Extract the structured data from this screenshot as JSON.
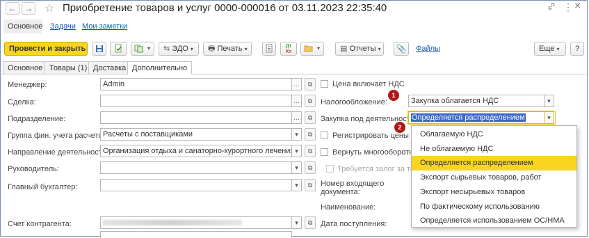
{
  "window": {
    "title": "Приобретение товаров и услуг 0000-000016 от 03.11.2023 22:35:40"
  },
  "nav": {
    "back": "←",
    "forward": "→",
    "star": "☆",
    "link_icon": "🔗",
    "menu_icon": "⋮",
    "close_icon": "×"
  },
  "top_tabs": [
    "Основное",
    "Задачи",
    "Мои заметки"
  ],
  "toolbar": {
    "post_close": "Провести и закрыть",
    "edo": "ЭДО",
    "print": "Печать",
    "reports": "Отчеты",
    "files": "Файлы",
    "more": "Еще",
    "help": "?"
  },
  "tabs": [
    "Основное",
    "Товары (1)",
    "Доставка",
    "Дополнительно"
  ],
  "left_fields": [
    {
      "label": "Менеджер:",
      "value": "Admin"
    },
    {
      "label": "Сделка:",
      "value": ""
    },
    {
      "label": "Подразделение:",
      "value": ""
    },
    {
      "label": "Группа фин. учета расчетов:",
      "value": "Расчеты с поставщиками"
    },
    {
      "label": "Направление деятельности:",
      "value": "Организация отдыха и санаторно-курортного лечения"
    },
    {
      "label": "Руководитель:",
      "value": ""
    },
    {
      "label": "Главный бухгалтер:",
      "value": ""
    },
    {
      "label": "Счет контрагента:",
      "value": ""
    }
  ],
  "right": {
    "price_vat_label": "Цена включает НДС",
    "taxation_label": "Налогообложение:",
    "taxation_value": "Закупка облагается НДС",
    "activity_label": "Закупка под деятельность:",
    "activity_value": "Определяется распределением",
    "register_label": "Регистрировать цены пос",
    "return_label": "Вернуть многооборотнук",
    "deposit_label": "Требуется залог за тару",
    "incoming_number_label": "Номер входящего документа:",
    "name_label": "Наименование:",
    "receipt_date_label": "Дата поступления:"
  },
  "badges": {
    "one": "1",
    "two": "2"
  },
  "dropdown": {
    "items": [
      "Облагаемую НДС",
      "Не облагаемую НДС",
      "Определяется распределением",
      "Экспорт сырьевых товаров, работ",
      "Экспорт несырьевых товаров",
      "По фактическому использованию",
      "Определяется использованием ОС/НМА"
    ],
    "selected_index": 2
  },
  "colors": {
    "accent": "#f8d51e",
    "badge": "#b01818",
    "link": "#1a57a8"
  }
}
